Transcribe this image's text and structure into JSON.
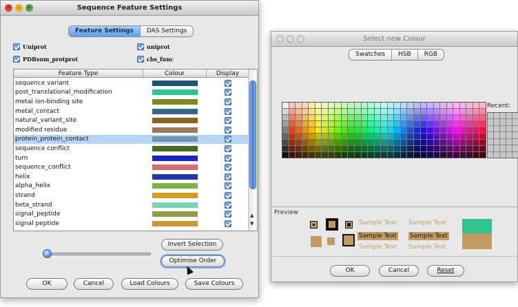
{
  "feature_window": {
    "title": "Sequence Feature Settings",
    "tabs": [
      {
        "label": "Feature Settings",
        "selected": true
      },
      {
        "label": "DAS Settings",
        "selected": false
      }
    ],
    "sources": [
      {
        "label": "Uniprot",
        "checked": true
      },
      {
        "label": "uniprot",
        "checked": true
      },
      {
        "label": "PDBsum_protprot",
        "checked": true
      },
      {
        "label": "cbs_func",
        "checked": true
      }
    ],
    "columns": [
      "Feature Type",
      "Colour",
      "Display"
    ],
    "rows": [
      {
        "name": "sequence variant",
        "colour": "#1f5273",
        "display": true,
        "selected": false
      },
      {
        "name": "post_translational_modification",
        "colour": "#2fc48e",
        "display": true,
        "selected": false
      },
      {
        "name": "metal ion-binding site",
        "colour": "#7d8a23",
        "display": true,
        "selected": false
      },
      {
        "name": "metal_contact",
        "colour": "#37688c",
        "display": true,
        "selected": false
      },
      {
        "name": "natural_variant_site",
        "colour": "#8a6420",
        "display": true,
        "selected": false
      },
      {
        "name": "modified residue",
        "colour": "#a0795a",
        "display": true,
        "selected": false
      },
      {
        "name": "protein_protein_contact",
        "colour": "#6f95b5",
        "display": true,
        "selected": true
      },
      {
        "name": "sequence conflict",
        "colour": "#466a1e",
        "display": true,
        "selected": false
      },
      {
        "name": "turn",
        "colour": "#1826b5",
        "display": true,
        "selected": false
      },
      {
        "name": "sequence_conflict",
        "colour": "#d56d74",
        "display": true,
        "selected": false
      },
      {
        "name": "helix",
        "colour": "#2436ad",
        "display": true,
        "selected": false
      },
      {
        "name": "alpha_helix",
        "colour": "#79b546",
        "display": true,
        "selected": false
      },
      {
        "name": "strand",
        "colour": "#d69b22",
        "display": true,
        "selected": false
      },
      {
        "name": "beta_strand",
        "colour": "#79d2b5",
        "display": true,
        "selected": false
      },
      {
        "name": "signal_peptide",
        "colour": "#8e9e46",
        "display": true,
        "selected": false
      },
      {
        "name": "signal peptide",
        "colour": "#c99a2e",
        "display": true,
        "selected": false
      }
    ],
    "transparency_slider_value": 0.0,
    "buttons": {
      "invert_selection": "Invert Selection",
      "optimise_order": "Optimise Order",
      "ok": "OK",
      "cancel": "Cancel",
      "load_colours": "Load Colours",
      "save_colours": "Save Colours"
    }
  },
  "colour_window": {
    "title": "Select new Colour",
    "tabs": [
      {
        "label": "Swatches",
        "selected": true
      },
      {
        "label": "HSB",
        "selected": false
      },
      {
        "label": "RGB",
        "selected": false
      }
    ],
    "recent_label": "Recent:",
    "preview_label": "Preview",
    "sample_text": "Sample Text",
    "current_colour": "#c29b62",
    "preview_new_colour": "#2fc48e",
    "buttons": {
      "ok": "OK",
      "cancel": "Cancel",
      "reset": "Reset"
    }
  }
}
